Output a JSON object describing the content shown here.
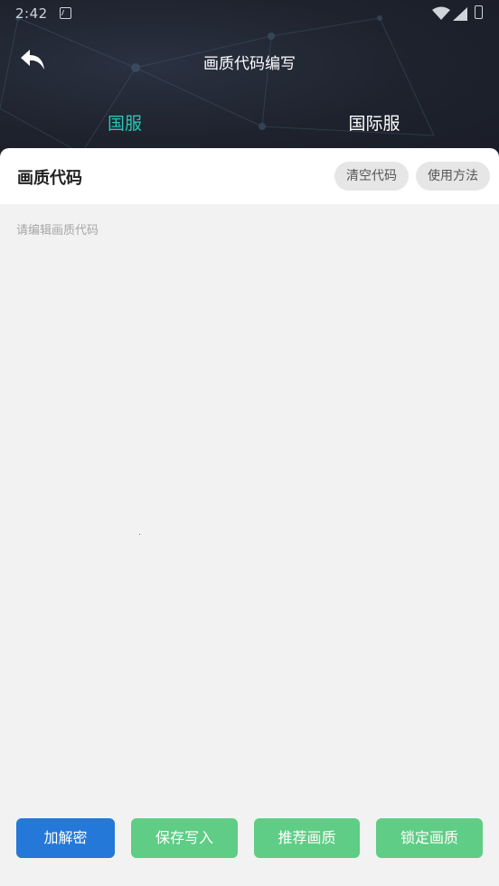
{
  "statusbar": {
    "time": "2:42"
  },
  "header": {
    "title": "画质代码编写"
  },
  "tabs": [
    {
      "label": "国服",
      "active": true
    },
    {
      "label": "国际服",
      "active": false
    }
  ],
  "card": {
    "title": "画质代码",
    "clear_label": "清空代码",
    "help_label": "使用方法"
  },
  "editor": {
    "placeholder": "请编辑画质代码",
    "value": ""
  },
  "buttons": {
    "decrypt": "加解密",
    "save_write": "保存写入",
    "recommend": "推荐画质",
    "lock": "锁定画质"
  },
  "colors": {
    "accent": "#2ec4b6",
    "primary_blue": "#2478d8",
    "green": "#5fcd85",
    "header_bg": "#1e222d"
  },
  "icons": {
    "back": "back-arrow-icon",
    "wifi": "wifi-icon",
    "signal": "signal-icon",
    "battery": "battery-icon",
    "notification": "notification-icon"
  }
}
